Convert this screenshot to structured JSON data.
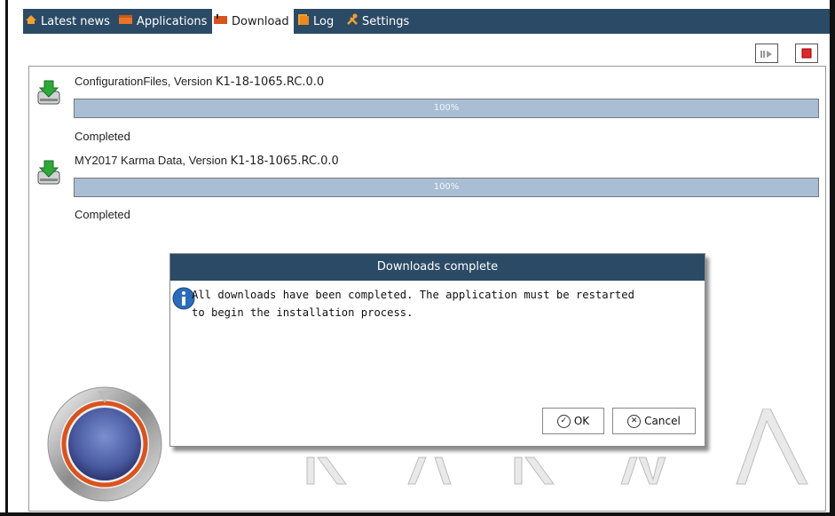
{
  "tabs": [
    {
      "label": "Latest news",
      "icon": "home-icon"
    },
    {
      "label": "Applications",
      "icon": "applications-icon"
    },
    {
      "label": "Download",
      "icon": "download-icon",
      "active": true
    },
    {
      "label": "Log",
      "icon": "log-icon"
    },
    {
      "label": "Settings",
      "icon": "settings-icon"
    }
  ],
  "toolbar": {
    "resume_icon": "resume-icon",
    "stop_icon": "stop-icon"
  },
  "downloads": [
    {
      "name": "ConfigurationFiles, Version",
      "version": "K1-18-1065.RC.0.0",
      "progress_text": "100%",
      "progress": 1.0,
      "status": "Completed"
    },
    {
      "name": "MY2017 Karma Data, Version",
      "version": "K1-18-1065.RC.0.0",
      "progress_text": "100%",
      "progress": 1.0,
      "status": "Completed"
    }
  ],
  "dialog": {
    "title": "Downloads complete",
    "message_line1": "All downloads have been completed. The application must be restarted",
    "message_line2": "to begin the installation process.",
    "ok_label": "OK",
    "cancel_label": "Cancel"
  },
  "colors": {
    "titlebar": "#2b4a66",
    "progress": "#a9bed4",
    "stop": "#e0282a"
  }
}
